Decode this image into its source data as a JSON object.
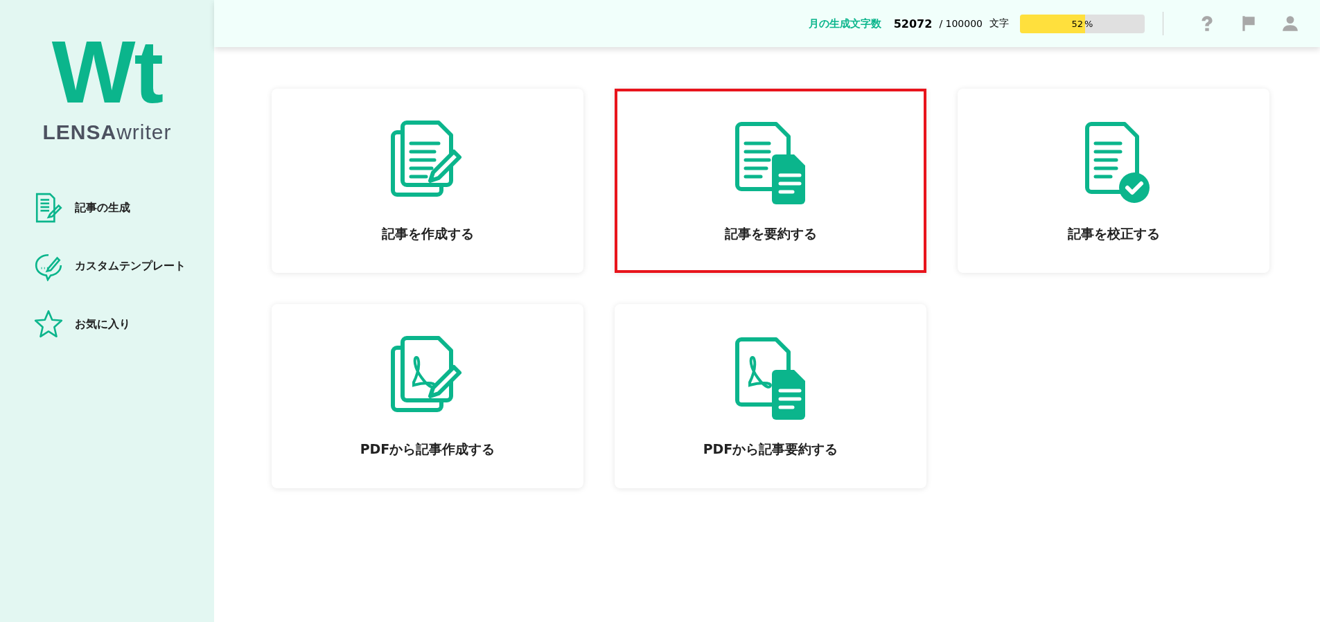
{
  "sidebar": {
    "logo_mark": "Wt",
    "logo_text": "**LENSA**writer",
    "items": [
      {
        "label": "記事の生成",
        "kind": "document-pen"
      },
      {
        "label": "カスタムテンプレート",
        "kind": "chat-pen"
      },
      {
        "label": "お気に入り",
        "kind": "star"
      }
    ]
  },
  "header": {
    "usage_label": "月の生成文字数",
    "used": "52072",
    "limit": "/ 100000",
    "unit": "文字",
    "progress": {
      "level": 0.52,
      "value": "52",
      "unit": "%"
    }
  },
  "cards": [
    {
      "label": "記事を作成する",
      "kind": "write",
      "selected": false
    },
    {
      "label": "記事を要約する",
      "kind": "summarize",
      "selected": true
    },
    {
      "label": "記事を校正する",
      "kind": "proofread",
      "selected": false
    },
    {
      "label": "PDFから記事作成する",
      "kind": "pdf-write",
      "selected": false
    },
    {
      "label": "PDFから記事要約する",
      "kind": "pdf-summarize",
      "selected": false
    }
  ]
}
